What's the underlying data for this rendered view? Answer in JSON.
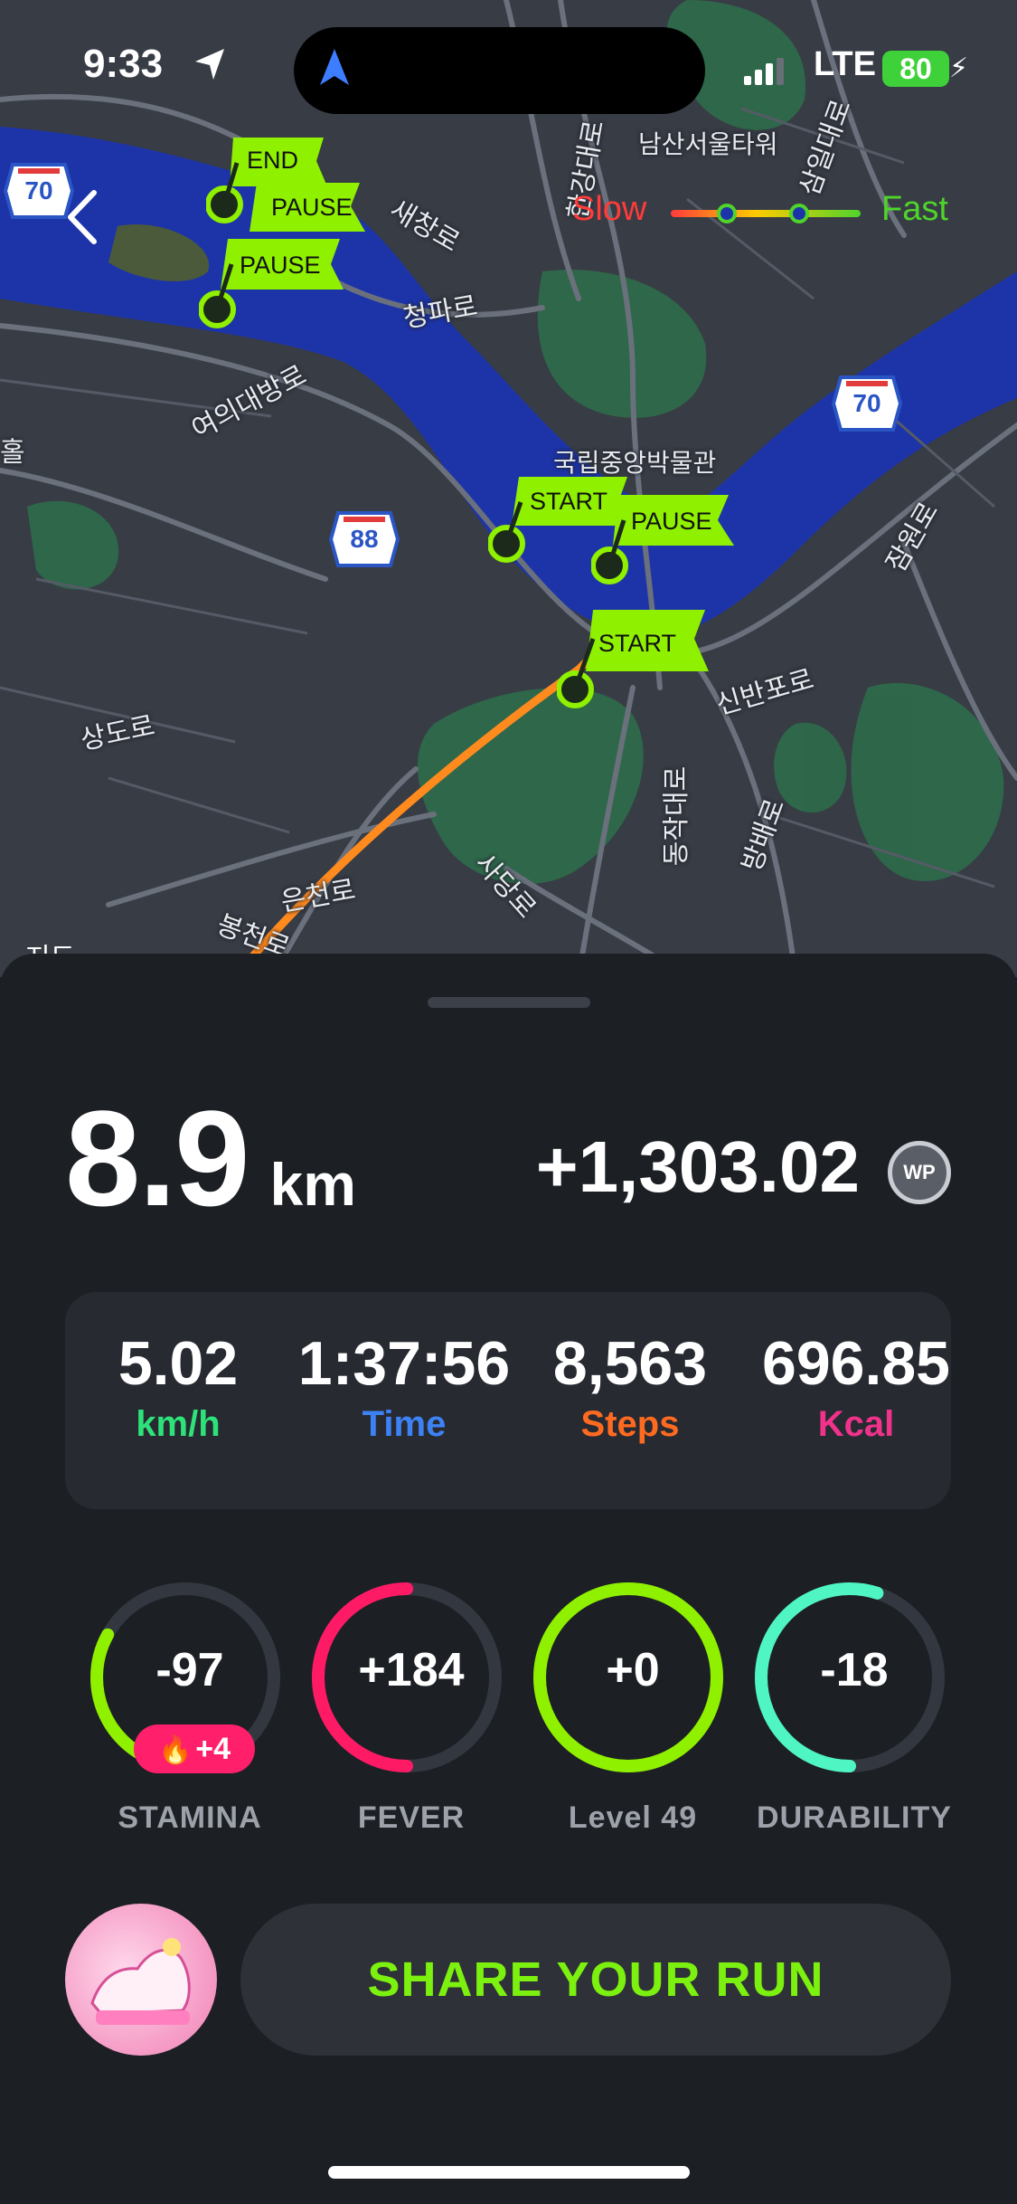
{
  "status_bar": {
    "time": "9:33",
    "network": "LTE",
    "battery": "80",
    "icons": [
      "location-arrow-icon",
      "navigation-icon",
      "signal-bars-icon",
      "battery-icon"
    ]
  },
  "map": {
    "labels": {
      "namsan_tower": "남산서울타워",
      "museum": "국립중앙박물관",
      "saechang_ro": "새창로",
      "cheongpa_ro": "청파로",
      "yeouidaebang_ro": "여의대방로",
      "sinban_po_ro": "신반포로",
      "dongjak_daero": "동작대로",
      "sadang_ro": "사당로",
      "bangbae_ro": "방배로",
      "sangdo_ro": "상도로",
      "euncheon_ro": "은천로",
      "bongcheon_ro": "봉천로",
      "jamwon_ro": "잠원로",
      "samil_daero": "삼일대로",
      "hangang_daero": "한강대로",
      "edge_label_left": "홀",
      "credit": "지도"
    },
    "route_shields": {
      "shield_70_left": "70",
      "shield_88": "88",
      "shield_70_right": "70"
    },
    "speed_legend": {
      "slow": "Slow",
      "fast": "Fast"
    },
    "flags": {
      "end": "END",
      "pause_1": "PAUSE",
      "pause_2": "PAUSE",
      "start_1": "START",
      "pause_3": "PAUSE",
      "start_2": "START"
    }
  },
  "summary": {
    "distance_value": "8.9",
    "distance_unit": "km",
    "points": "+1,303.02",
    "points_badge": "WP"
  },
  "stats": [
    {
      "value": "5.02",
      "label": "km/h",
      "color": "#2ee27a"
    },
    {
      "value": "1:37:56",
      "label": "Time",
      "color": "#3d82f5"
    },
    {
      "value": "8,563",
      "label": "Steps",
      "color": "#ff6a21"
    },
    {
      "value": "696.85",
      "label": "Kcal",
      "color": "#f0328a"
    }
  ],
  "gauges": [
    {
      "value": "-97",
      "label": "STAMINA",
      "color": "#8ff000",
      "fraction": 0.33,
      "bonus": "+4"
    },
    {
      "value": "+184",
      "label": "FEVER",
      "color": "#ff1a66",
      "fraction": 0.5
    },
    {
      "value": "+0",
      "label": "Level 49",
      "color": "#8ff000",
      "fraction": 1.0
    },
    {
      "value": "-18",
      "label": "DURABILITY",
      "color": "#4ff5c3",
      "fraction": 0.55
    }
  ],
  "share": {
    "label": "SHARE YOUR RUN"
  }
}
